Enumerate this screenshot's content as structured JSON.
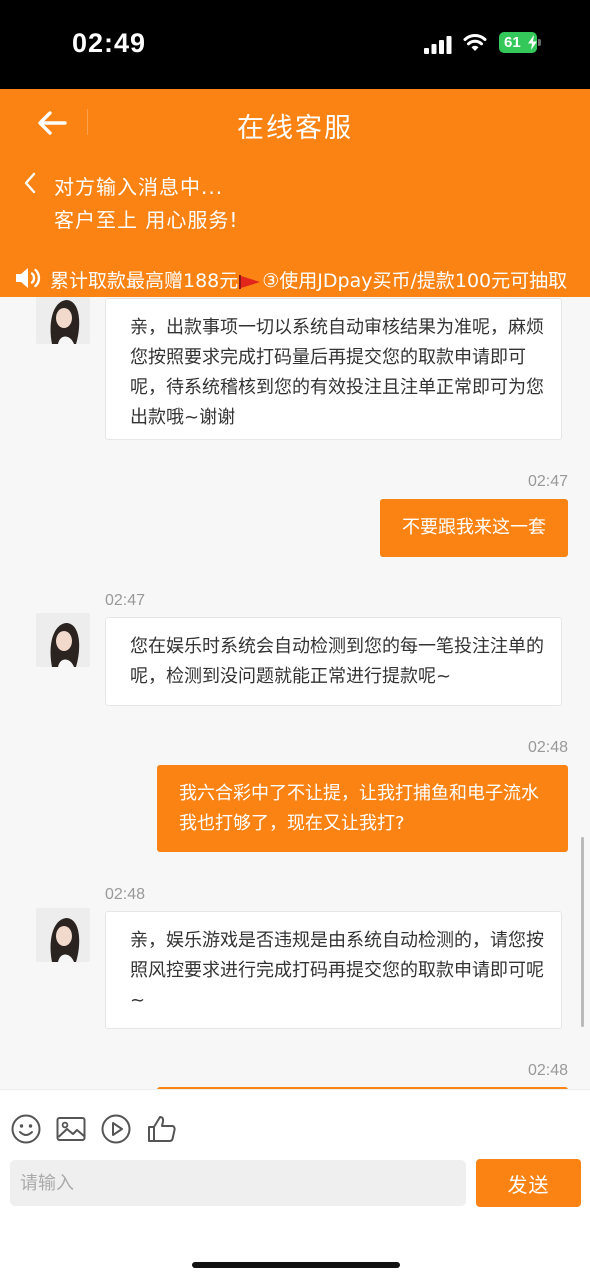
{
  "status_bar": {
    "time": "02:49",
    "battery": "61"
  },
  "header": {
    "title": "在线客服",
    "typing": "对方输入消息中...",
    "slogan": "客户至上 用心服务!",
    "marquee_left": "累计取款最高赠188元",
    "marquee_right": "③使用JDpay买币/提款100元可抽取"
  },
  "colors": {
    "brand": "#fb8314",
    "status_bar": "#000000",
    "battery": "#34c759"
  },
  "messages": [
    {
      "side": "agent",
      "time": "",
      "text": "亲，出款事项一切以系统自动审核结果为准呢，麻烦您按照要求完成打码量后再提交您的取款申请即可呢，待系统稽核到您的有效投注且注单正常即可为您出款哦~谢谢"
    },
    {
      "side": "user",
      "time": "02:47",
      "text": "不要跟我来这一套"
    },
    {
      "side": "agent",
      "time": "02:47",
      "text": "您在娱乐时系统会自动检测到您的每一笔投注注单的呢，检测到没问题就能正常进行提款呢~"
    },
    {
      "side": "user",
      "time": "02:48",
      "text": "我六合彩中了不让提，让我打捕鱼和电子流水我也打够了，现在又让我打?"
    },
    {
      "side": "agent",
      "time": "02:48",
      "text": "亲，娱乐游戏是否违规是由系统自动检测的，请您按照风控要求进行完成打码再提交您的取款申请即可呢~"
    },
    {
      "side": "user",
      "time": "02:48",
      "text": ""
    }
  ],
  "toolbar": {
    "icons": [
      "emoji-icon",
      "image-icon",
      "video-icon",
      "thumbs-up-icon"
    ],
    "input_placeholder": "请输入",
    "send_label": "发送"
  }
}
